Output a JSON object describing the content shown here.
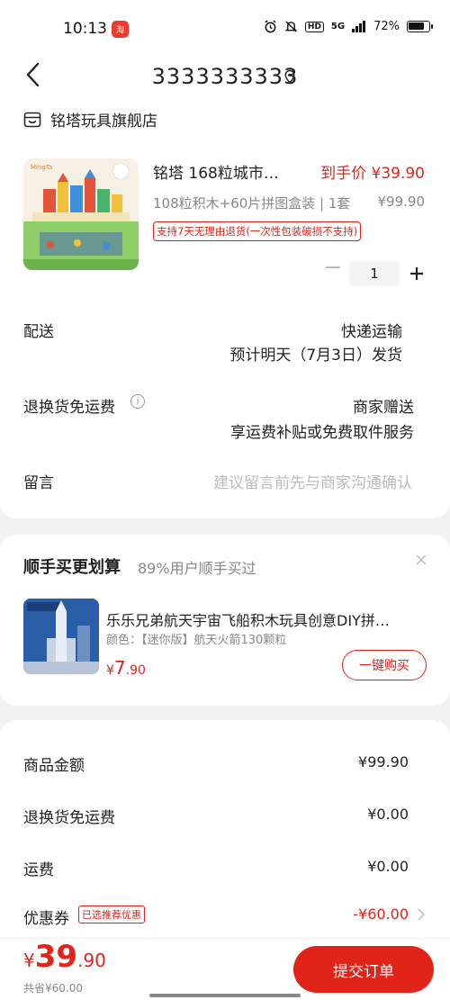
{
  "status_bar": {
    "time": "10:13",
    "battery": "72%",
    "network": "5G",
    "hd": "HD"
  },
  "header": {
    "title": "3333333333"
  },
  "store": {
    "name": "铭塔玩具旗舰店"
  },
  "product": {
    "title": "铭塔 168粒城市…",
    "price_label": "到手价 ¥39.90",
    "spec": "108粒积木+60片拼图盒装 | 1套",
    "original_price": "¥99.90",
    "return_tag": "支持7天无理由退货(一次性包装破损不支持)",
    "quantity": "1"
  },
  "shipping": {
    "label": "配送",
    "method": "快递运输",
    "eta": "预计明天（7月3日）发货"
  },
  "return_shipping": {
    "label": "退换货免运费",
    "value": "商家赠送",
    "detail": "享运费补贴或免费取件服务"
  },
  "note": {
    "label": "留言",
    "placeholder": "建议留言前先与商家沟通确认"
  },
  "addon": {
    "title": "顺手买更划算",
    "subtitle": "89%用户顺手买过",
    "name": "乐乐兄弟航天宇宙飞船积木玩具创意DIY拼…",
    "color_label": "颜色：【迷你版】航天火箭130颗粒",
    "price_symbol": "¥",
    "price_main": "7",
    "price_decimal": ".90",
    "button": "一键购买"
  },
  "summary": {
    "goods_label": "商品金额",
    "goods_value": "¥99.90",
    "return_label": "退换货免运费",
    "return_value": "¥0.00",
    "freight_label": "运费",
    "freight_value": "¥0.00",
    "coupon_label": "优惠券",
    "coupon_tag": "已选推荐优惠",
    "coupon_value": "-¥60.00"
  },
  "bottom": {
    "price_symbol": "¥",
    "price_main": "39",
    "price_decimal": ".90",
    "discount_text": "共省¥60.00",
    "submit_label": "提交订单"
  }
}
